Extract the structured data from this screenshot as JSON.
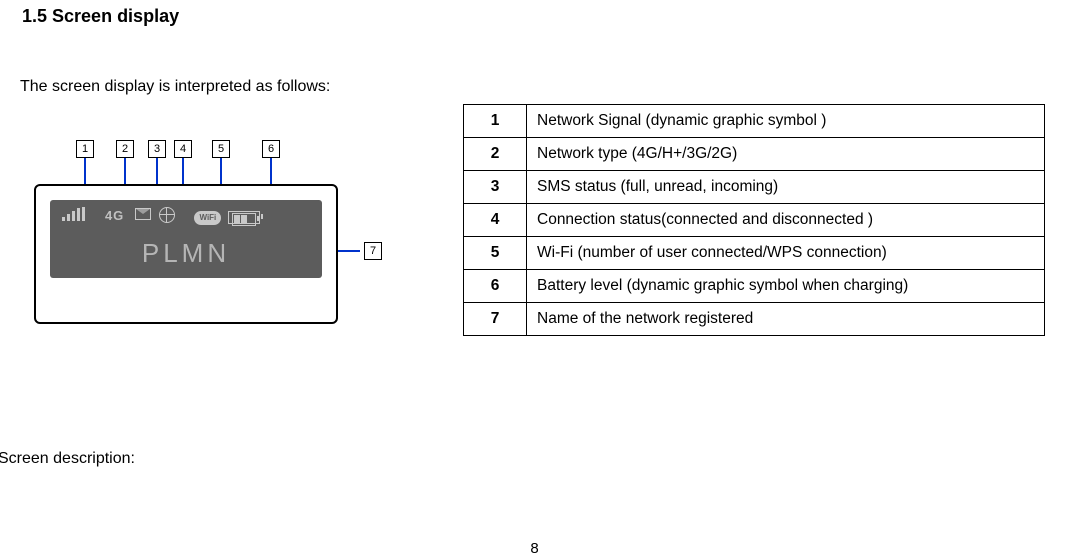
{
  "section_title": "1.5 Screen display",
  "intro": "The screen display is interpreted as follows:",
  "screen_description_heading": "Screen description:",
  "page_number": "8",
  "device_screen": {
    "network_type_text": "4G",
    "wifi_pill_text": "WiFi",
    "plmn_text": "PLMN"
  },
  "callouts": {
    "l1": "1",
    "l2": "2",
    "l3": "3",
    "l4": "4",
    "l5": "5",
    "l6": "6",
    "l7": "7"
  },
  "table": {
    "r1": {
      "num": "1",
      "desc": "Network Signal (dynamic graphic symbol )"
    },
    "r2": {
      "num": "2",
      "desc": "Network type (4G/H+/3G/2G)"
    },
    "r3": {
      "num": "3",
      "desc": "SMS status (full, unread, incoming)"
    },
    "r4": {
      "num": "4",
      "desc": "Connection status(connected and disconnected )"
    },
    "r5": {
      "num": "5",
      "desc": "Wi-Fi (number of user connected/WPS connection)"
    },
    "r6": {
      "num": "6",
      "desc": "Battery level (dynamic graphic symbol when charging)"
    },
    "r7": {
      "num": "7",
      "desc": "Name of the network registered"
    }
  }
}
